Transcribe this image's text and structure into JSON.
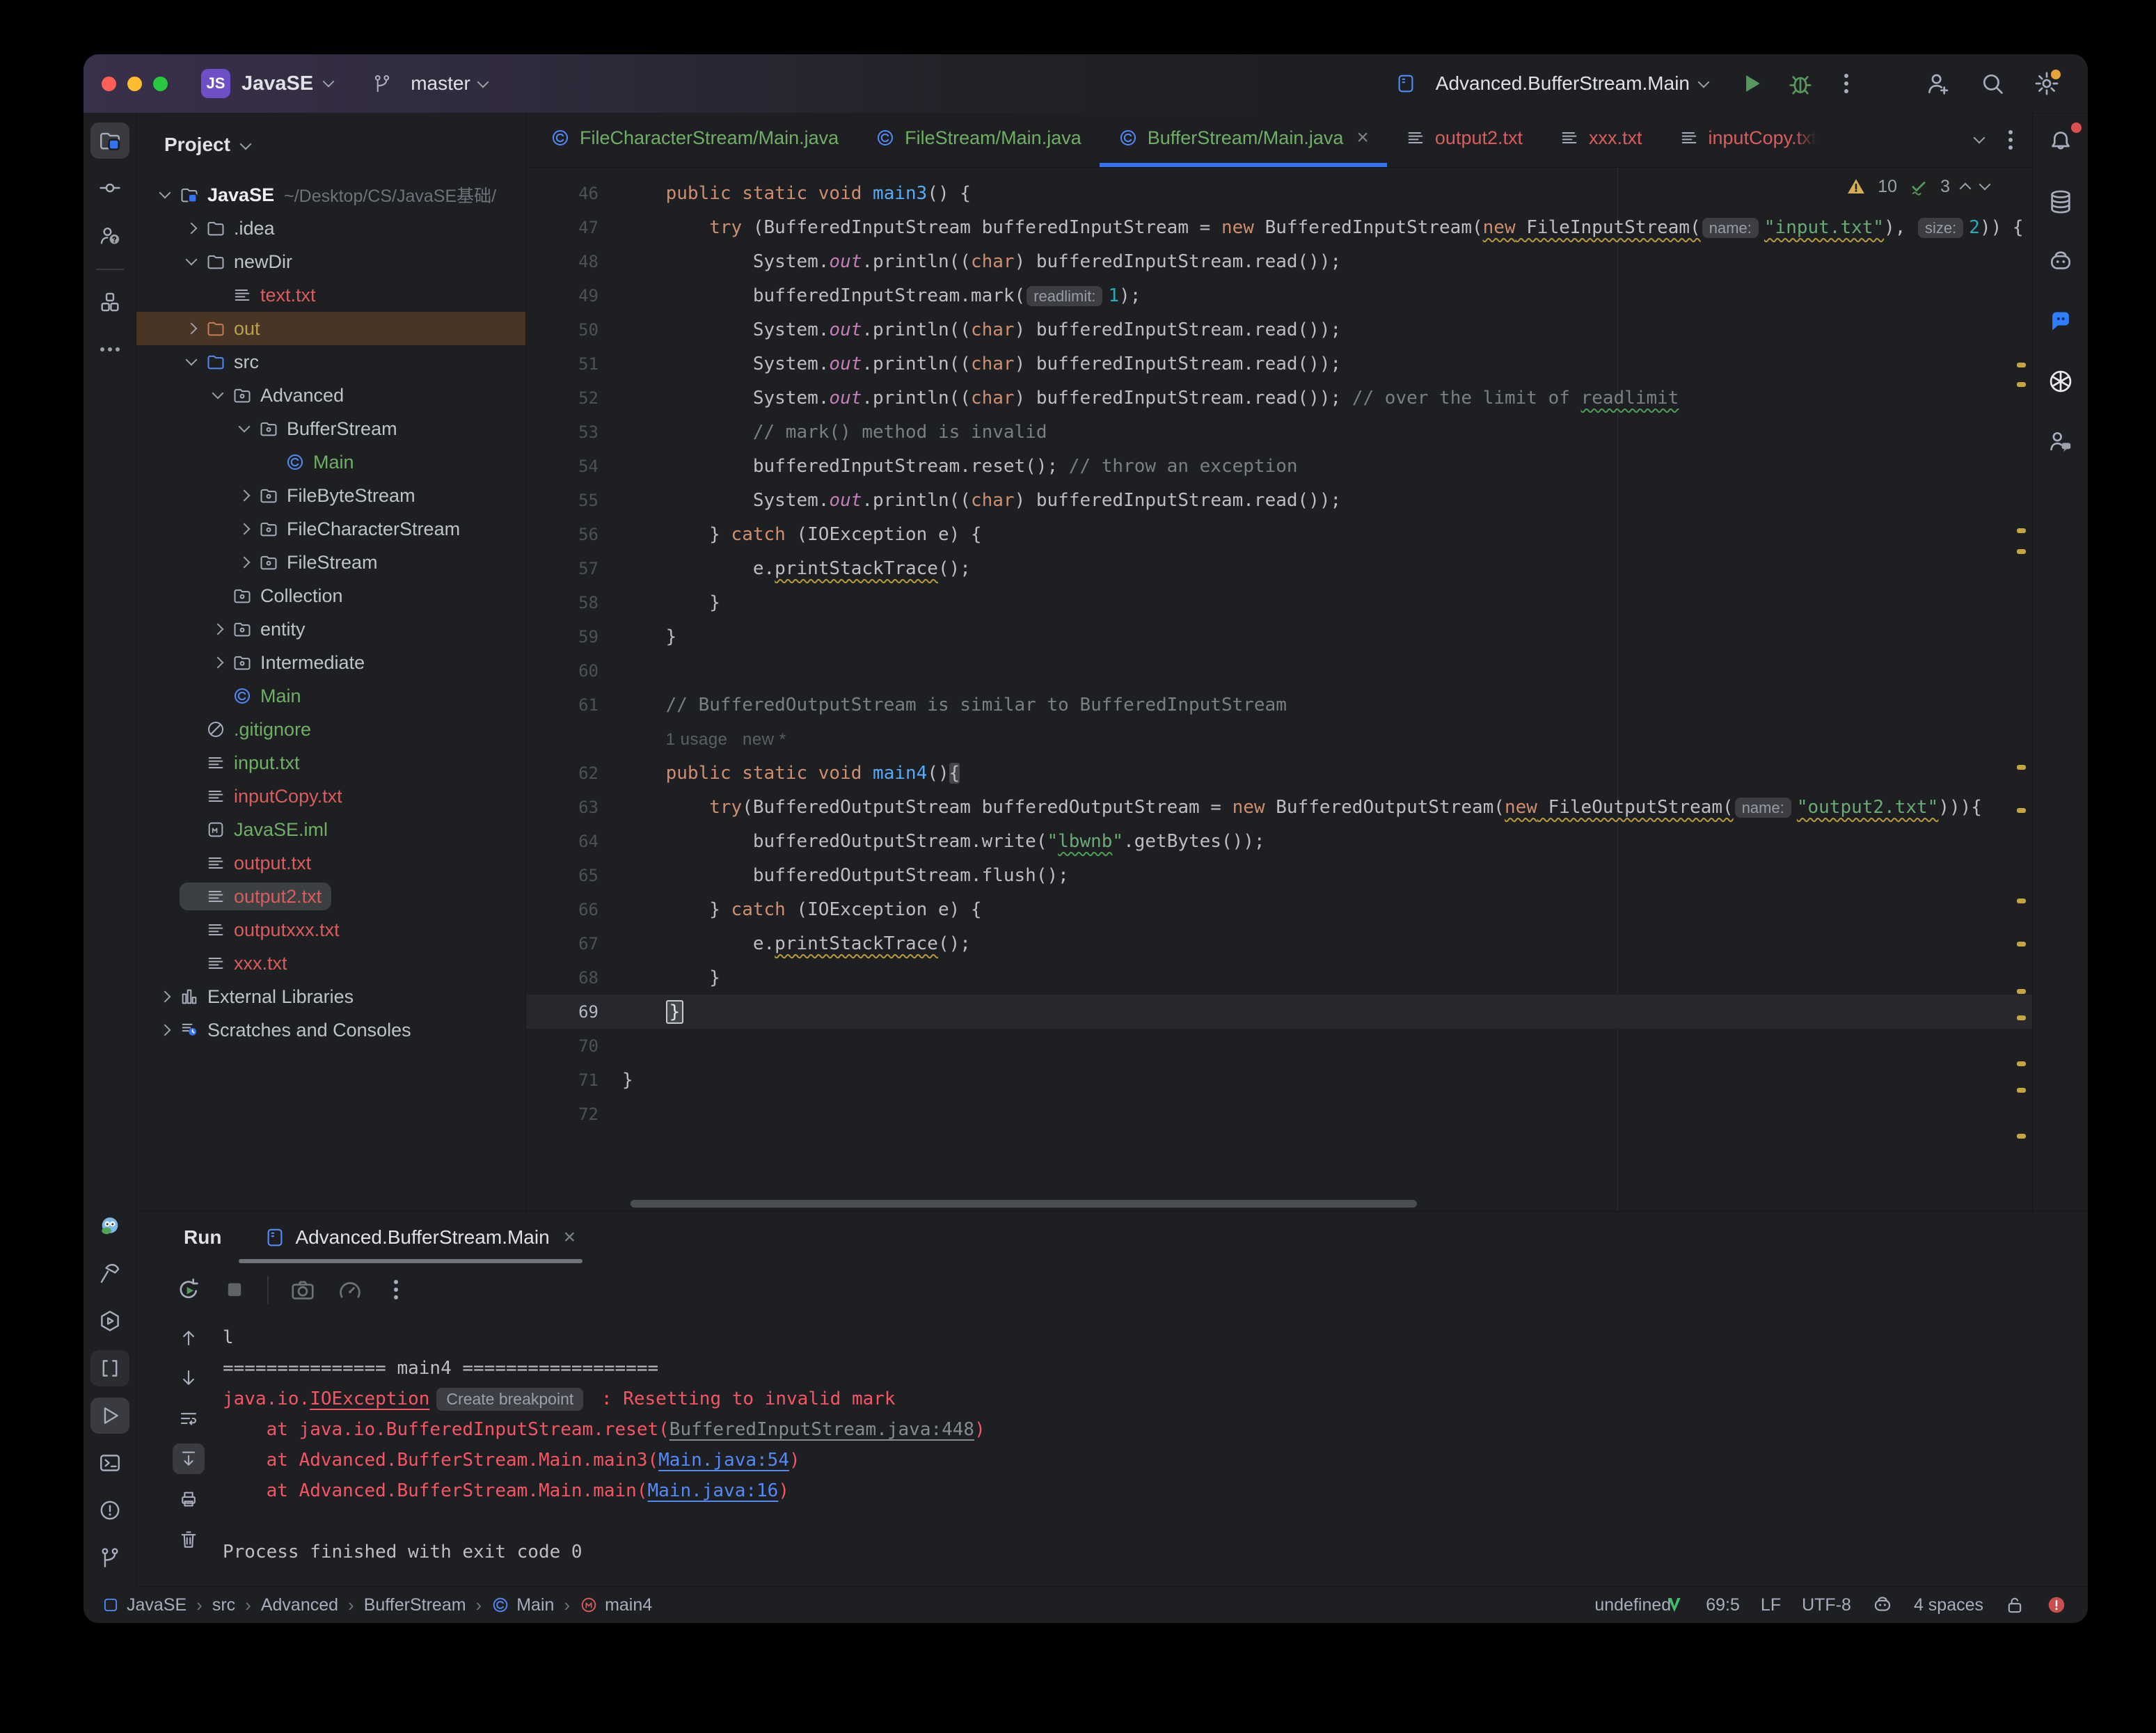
{
  "titlebar": {
    "project_badge": "JS",
    "project_name": "JavaSE",
    "branch_name": "master",
    "run_config": "Advanced.BufferStream.Main",
    "traffic_lights": [
      "#FF5F57",
      "#FEBC2E",
      "#28C840"
    ]
  },
  "tabbar": {
    "tabs": [
      {
        "label": "FileCharacterStream/Main.java",
        "icon": "class",
        "color": "green",
        "active": false,
        "closable": false
      },
      {
        "label": "FileStream/Main.java",
        "icon": "class",
        "color": "green",
        "active": false,
        "closable": false
      },
      {
        "label": "BufferStream/Main.java",
        "icon": "class",
        "color": "green",
        "active": true,
        "closable": true
      },
      {
        "label": "output2.txt",
        "icon": "txt",
        "color": "red",
        "active": false,
        "closable": false
      },
      {
        "label": "xxx.txt",
        "icon": "txt",
        "color": "red",
        "active": false,
        "closable": false
      },
      {
        "label": "inputCopy.txt",
        "icon": "txt",
        "color": "red",
        "active": false,
        "closable": false,
        "truncated": true
      }
    ]
  },
  "inspections": {
    "warnings": "10",
    "typos": "3"
  },
  "project": {
    "header": "Project",
    "tree": [
      {
        "level": 0,
        "chev": "down",
        "icon": "project",
        "label": "JavaSE",
        "suffix": "~/Desktop/CS/JavaSE基础/",
        "bold": true
      },
      {
        "level": 1,
        "chev": "right",
        "icon": "folder",
        "label": ".idea"
      },
      {
        "level": 1,
        "chev": "down",
        "icon": "folder",
        "label": "newDir"
      },
      {
        "level": 2,
        "chev": null,
        "icon": "txt",
        "label": "text.txt",
        "color": "red"
      },
      {
        "level": 1,
        "chev": "right",
        "icon": "folder-out",
        "label": "out",
        "color": "olive",
        "row": "brown"
      },
      {
        "level": 1,
        "chev": "down",
        "icon": "folder-src",
        "label": "src"
      },
      {
        "level": 2,
        "chev": "down",
        "icon": "pkg",
        "label": "Advanced"
      },
      {
        "level": 3,
        "chev": "down",
        "icon": "pkg",
        "label": "BufferStream"
      },
      {
        "level": 4,
        "chev": null,
        "icon": "class",
        "label": "Main",
        "color": "green"
      },
      {
        "level": 3,
        "chev": "right",
        "icon": "pkg",
        "label": "FileByteStream"
      },
      {
        "level": 3,
        "chev": "right",
        "icon": "pkg",
        "label": "FileCharacterStream"
      },
      {
        "level": 3,
        "chev": "right",
        "icon": "pkg",
        "label": "FileStream"
      },
      {
        "level": 2,
        "chev": null,
        "icon": "pkg",
        "label": "Collection"
      },
      {
        "level": 2,
        "chev": "right",
        "icon": "pkg",
        "label": "entity"
      },
      {
        "level": 2,
        "chev": "right",
        "icon": "pkg",
        "label": "Intermediate"
      },
      {
        "level": 2,
        "chev": null,
        "icon": "class",
        "label": "Main",
        "color": "green"
      },
      {
        "level": 1,
        "chev": null,
        "icon": "gitignore",
        "label": ".gitignore",
        "color": "green"
      },
      {
        "level": 1,
        "chev": null,
        "icon": "txt",
        "label": "input.txt",
        "color": "green"
      },
      {
        "level": 1,
        "chev": null,
        "icon": "txt",
        "label": "inputCopy.txt",
        "color": "red"
      },
      {
        "level": 1,
        "chev": null,
        "icon": "iml",
        "label": "JavaSE.iml",
        "color": "green"
      },
      {
        "level": 1,
        "chev": null,
        "icon": "txt",
        "label": "output.txt",
        "color": "red"
      },
      {
        "level": 1,
        "chev": null,
        "icon": "txt",
        "label": "output2.txt",
        "color": "red",
        "row": "selected"
      },
      {
        "level": 1,
        "chev": null,
        "icon": "txt",
        "label": "outputxxx.txt",
        "color": "red"
      },
      {
        "level": 1,
        "chev": null,
        "icon": "txt",
        "label": "xxx.txt",
        "color": "red"
      },
      {
        "level": 0,
        "chev": "right",
        "icon": "lib",
        "label": "External Libraries"
      },
      {
        "level": 0,
        "chev": "right",
        "icon": "scratch",
        "label": "Scratches and Consoles"
      }
    ]
  },
  "editor": {
    "lines": [
      {
        "n": "46",
        "seg": [
          [
            "    ",
            ""
          ],
          [
            "public static void ",
            "kw"
          ],
          [
            "main3",
            "fn"
          ],
          [
            "() {",
            ""
          ]
        ]
      },
      {
        "n": "47",
        "seg": [
          [
            "        ",
            ""
          ],
          [
            "try",
            "kw"
          ],
          [
            " (BufferedInputStream bufferedInputStream = ",
            ""
          ],
          [
            "new",
            "kw"
          ],
          [
            " BufferedInputStream(",
            ""
          ],
          [
            "new",
            "kw wsq"
          ],
          [
            " FileInputStream(",
            "wsq"
          ],
          [
            "name:",
            "chip"
          ],
          [
            "\"input.txt\"",
            "str wsq"
          ],
          [
            "), ",
            ""
          ],
          [
            "size:",
            "chip"
          ],
          [
            "2",
            "num"
          ],
          [
            ")) {",
            ""
          ]
        ]
      },
      {
        "n": "48",
        "seg": [
          [
            "            ",
            ""
          ],
          [
            "System.",
            ""
          ],
          [
            "out",
            "fld"
          ],
          [
            ".println((",
            ""
          ],
          [
            "char",
            "kw"
          ],
          [
            ") bufferedInputStream.read());",
            ""
          ]
        ]
      },
      {
        "n": "49",
        "seg": [
          [
            "            ",
            ""
          ],
          [
            "bufferedInputStream.mark(",
            ""
          ],
          [
            "readlimit:",
            "chip"
          ],
          [
            "1",
            "num"
          ],
          [
            ");",
            ""
          ]
        ]
      },
      {
        "n": "50",
        "seg": [
          [
            "            ",
            ""
          ],
          [
            "System.",
            ""
          ],
          [
            "out",
            "fld"
          ],
          [
            ".println((",
            ""
          ],
          [
            "char",
            "kw"
          ],
          [
            ") bufferedInputStream.read());",
            ""
          ]
        ]
      },
      {
        "n": "51",
        "seg": [
          [
            "            ",
            ""
          ],
          [
            "System.",
            ""
          ],
          [
            "out",
            "fld"
          ],
          [
            ".println((",
            ""
          ],
          [
            "char",
            "kw"
          ],
          [
            ") bufferedInputStream.read());",
            ""
          ]
        ]
      },
      {
        "n": "52",
        "seg": [
          [
            "            ",
            ""
          ],
          [
            "System.",
            ""
          ],
          [
            "out",
            "fld"
          ],
          [
            ".println((",
            ""
          ],
          [
            "char",
            "kw"
          ],
          [
            ") bufferedInputStream.read()); ",
            ""
          ],
          [
            "// over the limit of ",
            "cmt"
          ],
          [
            "readlimit",
            "cmt gsq"
          ]
        ]
      },
      {
        "n": "53",
        "seg": [
          [
            "            ",
            ""
          ],
          [
            "// mark() method is invalid",
            "cmt"
          ]
        ]
      },
      {
        "n": "54",
        "seg": [
          [
            "            ",
            ""
          ],
          [
            "bufferedInputStream.reset(); ",
            ""
          ],
          [
            "// throw an exception",
            "cmt"
          ]
        ]
      },
      {
        "n": "55",
        "seg": [
          [
            "            ",
            ""
          ],
          [
            "System.",
            ""
          ],
          [
            "out",
            "fld"
          ],
          [
            ".println((",
            ""
          ],
          [
            "char",
            "kw"
          ],
          [
            ") bufferedInputStream.read());",
            ""
          ]
        ]
      },
      {
        "n": "56",
        "seg": [
          [
            "        } ",
            ""
          ],
          [
            "catch",
            "kw"
          ],
          [
            " (IOException e) {",
            ""
          ]
        ]
      },
      {
        "n": "57",
        "seg": [
          [
            "            ",
            ""
          ],
          [
            "e.",
            ""
          ],
          [
            "printStackTrace",
            "wsq"
          ],
          [
            "();",
            ""
          ]
        ]
      },
      {
        "n": "58",
        "seg": [
          [
            "        }",
            ""
          ]
        ]
      },
      {
        "n": "59",
        "seg": [
          [
            "    }",
            ""
          ]
        ]
      },
      {
        "n": "60",
        "seg": []
      },
      {
        "n": "61",
        "seg": [
          [
            "    ",
            ""
          ],
          [
            "// BufferedOutputStream is similar to BufferedInputStream",
            "cmt"
          ]
        ]
      },
      {
        "n": "",
        "seg": [
          [
            "    ",
            ""
          ],
          [
            "1 usage   new *",
            "usage"
          ]
        ]
      },
      {
        "n": "62",
        "seg": [
          [
            "    ",
            ""
          ],
          [
            "public static void ",
            "kw"
          ],
          [
            "main4",
            "fn"
          ],
          [
            "()",
            ""
          ],
          [
            "{",
            "brace"
          ]
        ]
      },
      {
        "n": "63",
        "seg": [
          [
            "        ",
            ""
          ],
          [
            "try",
            "kw"
          ],
          [
            "(BufferedOutputStream bufferedOutputStream = ",
            ""
          ],
          [
            "new",
            "kw"
          ],
          [
            " BufferedOutputStream(",
            ""
          ],
          [
            "new",
            "kw wsq"
          ],
          [
            " FileOutputStream(",
            "wsq"
          ],
          [
            "name:",
            "chip"
          ],
          [
            "\"output2.txt\"",
            "str wsq"
          ],
          [
            "))){",
            ""
          ]
        ]
      },
      {
        "n": "64",
        "seg": [
          [
            "            ",
            ""
          ],
          [
            "bufferedOutputStream.write(",
            ""
          ],
          [
            "\"",
            "str"
          ],
          [
            "lbwnb",
            "str gsq"
          ],
          [
            "\"",
            "str"
          ],
          [
            ".getBytes());",
            ""
          ]
        ]
      },
      {
        "n": "65",
        "seg": [
          [
            "            ",
            ""
          ],
          [
            "bufferedOutputStream.flush();",
            ""
          ]
        ]
      },
      {
        "n": "66",
        "seg": [
          [
            "        } ",
            ""
          ],
          [
            "catch",
            "kw"
          ],
          [
            " (IOException e) {",
            ""
          ]
        ]
      },
      {
        "n": "67",
        "seg": [
          [
            "            ",
            ""
          ],
          [
            "e.",
            ""
          ],
          [
            "printStackTrace",
            "wsq"
          ],
          [
            "();",
            ""
          ]
        ]
      },
      {
        "n": "68",
        "seg": [
          [
            "        }",
            ""
          ]
        ]
      },
      {
        "n": "69",
        "current": true,
        "seg": [
          [
            "    ",
            ""
          ],
          [
            "}",
            "caret"
          ]
        ]
      },
      {
        "n": "70",
        "seg": []
      },
      {
        "n": "71",
        "seg": [
          [
            "}",
            ""
          ]
        ]
      },
      {
        "n": "72",
        "seg": []
      }
    ],
    "scroll_marks_y": [
      280,
      308,
      518,
      548,
      858,
      920,
      1050,
      1112,
      1180,
      1218,
      1284,
      1322,
      1388
    ]
  },
  "run": {
    "label": "Run",
    "tab_label": "Advanced.BufferStream.Main",
    "console": [
      {
        "seg": [
          [
            "l",
            "w"
          ]
        ]
      },
      {
        "seg": [
          [
            "=============== main4 ==================",
            "w"
          ]
        ]
      },
      {
        "seg": [
          [
            "java.io.",
            "err"
          ],
          [
            "IOException",
            "err und"
          ],
          [
            "Create breakpoint",
            "chip"
          ],
          [
            " : Resetting to invalid mark",
            "err"
          ]
        ]
      },
      {
        "seg": [
          [
            "    at java.io.BufferedInputStream.reset(",
            "err"
          ],
          [
            "BufferedInputStream.java:448",
            "glink und"
          ],
          [
            ")",
            "err"
          ]
        ]
      },
      {
        "seg": [
          [
            "    at Advanced.BufferStream.Main.main3(",
            "err"
          ],
          [
            "Main.java:54",
            "blink und"
          ],
          [
            ")",
            "err"
          ]
        ]
      },
      {
        "seg": [
          [
            "    at Advanced.BufferStream.Main.main(",
            "err"
          ],
          [
            "Main.java:16",
            "blink und"
          ],
          [
            ")",
            "err"
          ]
        ]
      },
      {
        "seg": []
      },
      {
        "seg": [
          [
            "Process finished with exit code 0",
            "w"
          ]
        ]
      }
    ]
  },
  "statusbar": {
    "breadcrumbs": [
      {
        "icon": "module",
        "label": "JavaSE"
      },
      {
        "icon": null,
        "label": "src"
      },
      {
        "icon": null,
        "label": "Advanced"
      },
      {
        "icon": null,
        "label": "BufferStream"
      },
      {
        "icon": "classsm",
        "label": "Main"
      },
      {
        "icon": "method",
        "label": "main4"
      }
    ],
    "right_items": [
      {
        "icon": "knot"
      },
      {
        "icon": "vplugin"
      },
      {
        "text": "69:5"
      },
      {
        "text": "LF"
      },
      {
        "text": "UTF-8"
      },
      {
        "icon": "robot2"
      },
      {
        "text": "4 spaces"
      },
      {
        "icon": "lock"
      },
      {
        "icon": "errdot"
      }
    ]
  },
  "left_strip": {
    "top": [
      "project",
      "commit",
      "contributors",
      "divider",
      "structure",
      "more"
    ],
    "bottom": [
      "plugin",
      "build",
      "services",
      "brackets",
      "run",
      "terminal",
      "problems",
      "vcs"
    ],
    "active": [
      "project",
      "run"
    ],
    "dim": [
      "brackets"
    ]
  },
  "right_strip": [
    "notifications",
    "database",
    "ai-assistant",
    "chat",
    "gpt",
    "person-chat"
  ],
  "colors": {
    "accent": "#3574F0",
    "error": "#F75464",
    "keyword": "#CF8E6D",
    "string": "#6AAB73",
    "warning_mark": "#C5A53F"
  }
}
